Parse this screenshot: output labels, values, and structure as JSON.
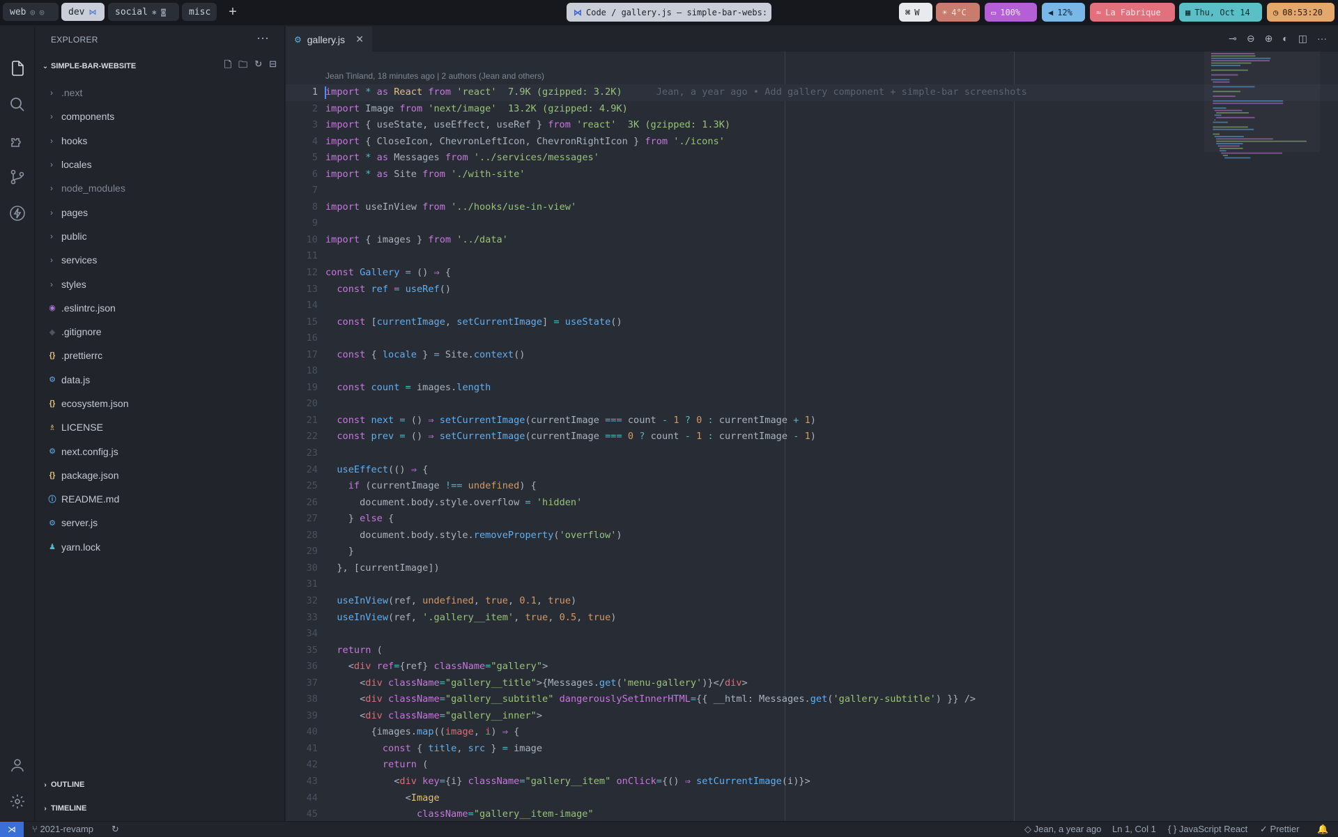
{
  "topbar": {
    "spaces": [
      {
        "label": "web",
        "icons": "◎ ◎",
        "active": false
      },
      {
        "label": "dev",
        "icons": "⋈",
        "active": true
      },
      {
        "label": "social",
        "icons": "✱ ◙",
        "active": false
      },
      {
        "label": "misc",
        "icons": "",
        "active": false
      }
    ],
    "add_space": "+",
    "window_title": "Code / gallery.js — simple-bar-webs:",
    "widgets": {
      "keyboard": "W",
      "weather": "4°C",
      "battery": "100%",
      "volume": "12%",
      "wifi": "La Fabrique",
      "date": "Thu, Oct 14",
      "time": "08:53:20"
    },
    "colors": {
      "weather": "#c97c6e",
      "battery": "#b55fd6",
      "volume": "#79b8e6",
      "wifi": "#e2707d",
      "date": "#5bbfc6",
      "time": "#e4a86a"
    }
  },
  "sidebar": {
    "title": "EXPLORER",
    "more": "···",
    "project": "SIMPLE-BAR-WEBSITE",
    "folders": [
      ".next",
      "components",
      "hooks",
      "locales",
      "node_modules",
      "pages",
      "public",
      "services",
      "styles"
    ],
    "dim_folders": [
      ".next",
      "node_modules"
    ],
    "files": [
      {
        "name": ".eslintrc.json",
        "icon": "eslint-icon",
        "glyph": "◉",
        "color": "#a976d8"
      },
      {
        "name": ".gitignore",
        "icon": "git-icon",
        "glyph": "◆",
        "color": "#4e5561"
      },
      {
        "name": ".prettierrc",
        "icon": "json-icon",
        "glyph": "{}",
        "color": "#e5c07b"
      },
      {
        "name": "data.js",
        "icon": "js-gear-icon",
        "glyph": "⚙",
        "color": "#61afef"
      },
      {
        "name": "ecosystem.json",
        "icon": "json-icon",
        "glyph": "{}",
        "color": "#e5c07b"
      },
      {
        "name": "LICENSE",
        "icon": "license-icon",
        "glyph": "♗",
        "color": "#e5c07b"
      },
      {
        "name": "next.config.js",
        "icon": "js-gear-icon",
        "glyph": "⚙",
        "color": "#61afef"
      },
      {
        "name": "package.json",
        "icon": "json-icon",
        "glyph": "{}",
        "color": "#e5c07b"
      },
      {
        "name": "README.md",
        "icon": "info-icon",
        "glyph": "ⓘ",
        "color": "#61afef"
      },
      {
        "name": "server.js",
        "icon": "js-gear-icon",
        "glyph": "⚙",
        "color": "#61afef"
      },
      {
        "name": "yarn.lock",
        "icon": "yarn-icon",
        "glyph": "♟",
        "color": "#56b6c2"
      }
    ],
    "sections": [
      "OUTLINE",
      "TIMELINE"
    ]
  },
  "editor": {
    "tab": "gallery.js",
    "blame_header": "Jean Tinland, 18 minutes ago | 2 authors (Jean and others)",
    "inline_blame": "Jean, a year ago • Add gallery component + simple-bar screenshots",
    "lines": [
      "<span class=\"kw\">import</span> <span class=\"op\">*</span> <span class=\"kw\">as</span> <span class=\"cls\">React</span> <span class=\"kw\">from</span> <span class=\"str\">'react'</span>  <span class=\"str\">7.9K (gzipped: 3.2K)</span>",
      "<span class=\"kw\">import</span> Image <span class=\"kw\">from</span> <span class=\"str\">'next/image'</span>  <span class=\"str\">13.2K (gzipped: 4.9K)</span>",
      "<span class=\"kw\">import</span> { useState, useEffect, useRef } <span class=\"kw\">from</span> <span class=\"str\">'react'</span>  <span class=\"str\">3K (gzipped: 1.3K)</span>",
      "<span class=\"kw\">import</span> { CloseIcon, ChevronLeftIcon, ChevronRightIcon } <span class=\"kw\">from</span> <span class=\"str\">'./icons'</span>",
      "<span class=\"kw\">import</span> <span class=\"op\">*</span> <span class=\"kw\">as</span> Messages <span class=\"kw\">from</span> <span class=\"str\">'../services/messages'</span>",
      "<span class=\"kw\">import</span> <span class=\"op\">*</span> <span class=\"kw\">as</span> Site <span class=\"kw\">from</span> <span class=\"str\">'./with-site'</span>",
      "",
      "<span class=\"kw\">import</span> useInView <span class=\"kw\">from</span> <span class=\"str\">'../hooks/use-in-view'</span>",
      "",
      "<span class=\"kw\">import</span> { images } <span class=\"kw\">from</span> <span class=\"str\">'../data'</span>",
      "",
      "<span class=\"kw\">const</span> <span class=\"fn\">Gallery</span> <span class=\"op\">=</span> () <span class=\"kw\">⇒</span> {",
      "  <span class=\"kw\">const</span> <span class=\"fn\">ref</span> <span class=\"op\">=</span> <span class=\"fn\">useRef</span>()",
      "",
      "  <span class=\"kw\">const</span> [<span class=\"fn\">currentImage</span>, <span class=\"fn\">setCurrentImage</span>] <span class=\"op\">=</span> <span class=\"fn\">useState</span>()",
      "",
      "  <span class=\"kw\">const</span> { <span class=\"fn\">locale</span> } <span class=\"op\">=</span> Site.<span class=\"fn\">context</span>()",
      "",
      "  <span class=\"kw\">const</span> <span class=\"fn\">count</span> <span class=\"op\">=</span> images.<span class=\"fn\">length</span>",
      "",
      "  <span class=\"kw\">const</span> <span class=\"fn\">next</span> <span class=\"op\">=</span> () <span class=\"kw\">⇒</span> <span class=\"fn\">setCurrentImage</span>(currentImage <span class=\"op\">===</span> count <span class=\"op\">-</span> <span class=\"num-c\">1</span> <span class=\"op\">?</span> <span class=\"num-c\">0</span> <span class=\"op\">:</span> currentImage <span class=\"op\">+</span> <span class=\"num-c\">1</span>)",
      "  <span class=\"kw\">const</span> <span class=\"fn\">prev</span> <span class=\"op\">=</span> () <span class=\"kw\">⇒</span> <span class=\"fn\">setCurrentImage</span>(currentImage <span class=\"op\">===</span> <span class=\"num-c\">0</span> <span class=\"op\">?</span> count <span class=\"op\">-</span> <span class=\"num-c\">1</span> <span class=\"op\">:</span> currentImage <span class=\"op\">-</span> <span class=\"num-c\">1</span>)",
      "",
      "  <span class=\"fn\">useEffect</span>(() <span class=\"kw\">⇒</span> {",
      "    <span class=\"kw\">if</span> (currentImage <span class=\"op\">!==</span> <span class=\"num-c\">undefined</span>) {",
      "      document.body.style.overflow <span class=\"op\">=</span> <span class=\"str\">'hidden'</span>",
      "    } <span class=\"kw\">else</span> {",
      "      document.body.style.<span class=\"fn\">removeProperty</span>(<span class=\"str\">'overflow'</span>)",
      "    }",
      "  }, [currentImage])",
      "",
      "  <span class=\"fn\">useInView</span>(ref, <span class=\"num-c\">undefined</span>, <span class=\"num-c\">true</span>, <span class=\"num-c\">0.1</span>, <span class=\"num-c\">true</span>)",
      "  <span class=\"fn\">useInView</span>(ref, <span class=\"str\">'.gallery__item'</span>, <span class=\"num-c\">true</span>, <span class=\"num-c\">0.5</span>, <span class=\"num-c\">true</span>)",
      "",
      "  <span class=\"kw\">return</span> (",
      "    &lt;<span class=\"var\">div</span> <span class=\"kw\">ref</span><span class=\"op\">=</span>{ref} <span class=\"kw\">className</span><span class=\"op\">=</span><span class=\"str\">\"gallery\"</span>&gt;",
      "      &lt;<span class=\"var\">div</span> <span class=\"kw\">className</span><span class=\"op\">=</span><span class=\"str\">\"gallery__title\"</span>&gt;{Messages.<span class=\"fn\">get</span>(<span class=\"str\">'menu-gallery'</span>)}&lt;/<span class=\"var\">div</span>&gt;",
      "      &lt;<span class=\"var\">div</span> <span class=\"kw\">className</span><span class=\"op\">=</span><span class=\"str\">\"gallery__subtitle\"</span> <span class=\"kw\">dangerouslySetInnerHTML</span><span class=\"op\">=</span>{{ __html: Messages.<span class=\"fn\">get</span>(<span class=\"str\">'gallery-subtitle'</span>) }} /&gt;",
      "      &lt;<span class=\"var\">div</span> <span class=\"kw\">className</span><span class=\"op\">=</span><span class=\"str\">\"gallery__inner\"</span>&gt;",
      "        {images.<span class=\"fn\">map</span>((<span class=\"var\">image</span>, <span class=\"var\">i</span>) <span class=\"kw\">⇒</span> {",
      "          <span class=\"kw\">const</span> { <span class=\"fn\">title</span>, <span class=\"fn\">src</span> } <span class=\"op\">=</span> image",
      "          <span class=\"kw\">return</span> (",
      "            &lt;<span class=\"var\">div</span> <span class=\"kw\">key</span><span class=\"op\">=</span>{i} <span class=\"kw\">className</span><span class=\"op\">=</span><span class=\"str\">\"gallery__item\"</span> <span class=\"kw\">onClick</span><span class=\"op\">=</span>{() <span class=\"kw\">⇒</span> <span class=\"fn\">setCurrentImage</span>(i)}&gt;",
      "              &lt;<span class=\"cls\">Image</span>",
      "                <span class=\"kw\">className</span><span class=\"op\">=</span><span class=\"str\">\"gallery__item-image\"</span>"
    ]
  },
  "statusbar": {
    "branch": "2021-revamp",
    "blame": "Jean, a year ago",
    "position": "Ln 1, Col 1",
    "language": "JavaScript React",
    "formatter": "Prettier"
  }
}
